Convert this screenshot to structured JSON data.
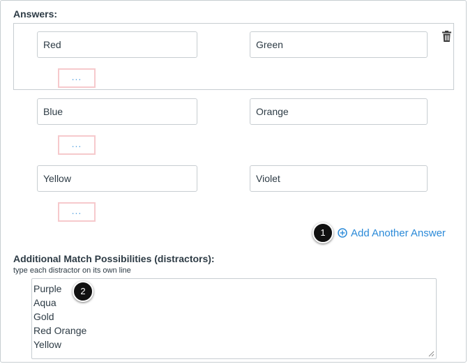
{
  "answers": {
    "label": "Answers:",
    "rows": [
      {
        "left": "Red",
        "right": "Green",
        "more_label": "..."
      },
      {
        "left": "Blue",
        "right": "Orange",
        "more_label": "..."
      },
      {
        "left": "Yellow",
        "right": "Violet",
        "more_label": "..."
      }
    ],
    "delete_icon": "trash-icon",
    "add_answer_icon": "plus-circle-icon",
    "add_answer_label": "Add Another Answer"
  },
  "callouts": {
    "first": "1",
    "second": "2"
  },
  "distractors": {
    "label": "Additional Match Possibilities (distractors):",
    "hint": "type each distractor on its own line",
    "lines": [
      "Purple",
      "Aqua",
      "Gold",
      "Red Orange",
      "Yellow"
    ]
  },
  "colors": {
    "link_blue": "#2b8ad8",
    "ellipsis_border": "#f6c9cc",
    "input_border": "#c7cdd1",
    "text": "#2d3b45",
    "callout_bg": "#111111"
  }
}
